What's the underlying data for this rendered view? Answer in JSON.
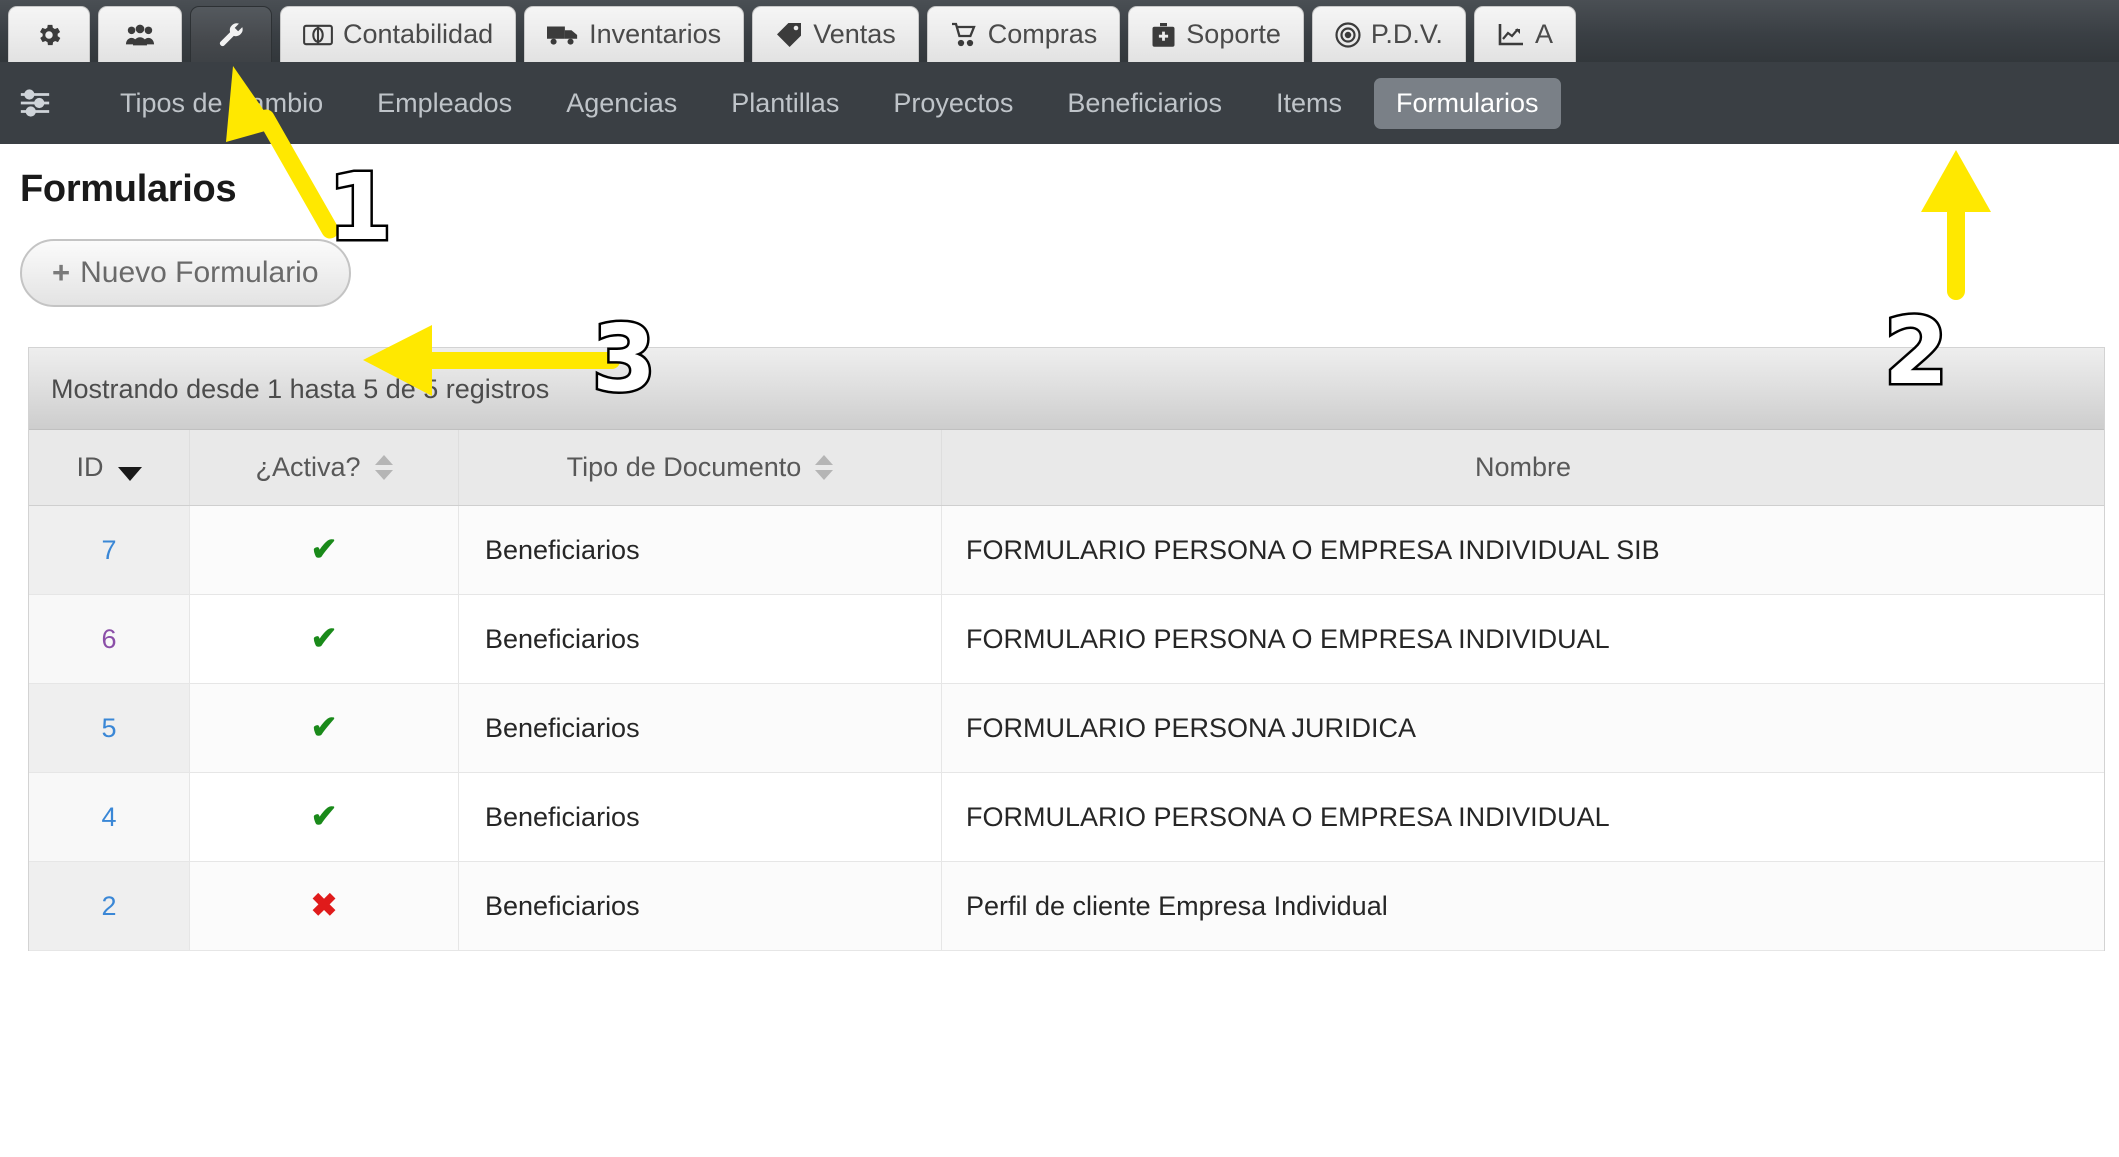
{
  "topbar": {
    "tabs": [
      {
        "label": "",
        "icon": "gear-icon",
        "icon_only": true,
        "active": false
      },
      {
        "label": "",
        "icon": "users-icon",
        "icon_only": true,
        "active": false
      },
      {
        "label": "",
        "icon": "wrench-icon",
        "icon_only": true,
        "active": true
      },
      {
        "label": "Contabilidad",
        "icon": "money-icon",
        "icon_only": false,
        "active": false
      },
      {
        "label": "Inventarios",
        "icon": "truck-icon",
        "icon_only": false,
        "active": false
      },
      {
        "label": "Ventas",
        "icon": "tag-icon",
        "icon_only": false,
        "active": false
      },
      {
        "label": "Compras",
        "icon": "cart-icon",
        "icon_only": false,
        "active": false
      },
      {
        "label": "Soporte",
        "icon": "briefcase-medical-icon",
        "icon_only": false,
        "active": false
      },
      {
        "label": "P.D.V.",
        "icon": "target-icon",
        "icon_only": false,
        "active": false
      },
      {
        "label": "A",
        "icon": "chart-line-icon",
        "icon_only": false,
        "active": false
      }
    ]
  },
  "submenu": {
    "icon": "sliders-icon",
    "items": [
      {
        "label": "Tipos de Cambio",
        "active": false
      },
      {
        "label": "Empleados",
        "active": false
      },
      {
        "label": "Agencias",
        "active": false
      },
      {
        "label": "Plantillas",
        "active": false
      },
      {
        "label": "Proyectos",
        "active": false
      },
      {
        "label": "Beneficiarios",
        "active": false
      },
      {
        "label": "Items",
        "active": false
      },
      {
        "label": "Formularios",
        "active": true
      }
    ]
  },
  "page": {
    "title": "Formularios",
    "new_button_label": "Nuevo Formulario",
    "new_button_plus": "+"
  },
  "table": {
    "info": "Mostrando desde 1 hasta 5 de 5 registros",
    "columns": [
      {
        "label": "ID",
        "sort": "desc"
      },
      {
        "label": "¿Activa?",
        "sort": "both"
      },
      {
        "label": "Tipo de Documento",
        "sort": "both"
      },
      {
        "label": "Nombre",
        "sort": "none"
      }
    ],
    "rows": [
      {
        "id": "7",
        "id_visited": false,
        "activa": "check",
        "tipo": "Beneficiarios",
        "nombre": "FORMULARIO PERSONA O EMPRESA INDIVIDUAL SIB"
      },
      {
        "id": "6",
        "id_visited": true,
        "activa": "check",
        "tipo": "Beneficiarios",
        "nombre": "FORMULARIO PERSONA O EMPRESA INDIVIDUAL"
      },
      {
        "id": "5",
        "id_visited": false,
        "activa": "check",
        "tipo": "Beneficiarios",
        "nombre": "FORMULARIO PERSONA JURIDICA"
      },
      {
        "id": "4",
        "id_visited": false,
        "activa": "check",
        "tipo": "Beneficiarios",
        "nombre": "FORMULARIO PERSONA O EMPRESA INDIVIDUAL"
      },
      {
        "id": "2",
        "id_visited": false,
        "activa": "cross",
        "tipo": "Beneficiarios",
        "nombre": "Perfil de cliente Empresa Individual"
      }
    ],
    "check_glyph": "✔",
    "cross_glyph": "✖"
  },
  "annotations": {
    "color": "#FFE800",
    "markers": [
      {
        "number": "1"
      },
      {
        "number": "2"
      },
      {
        "number": "3"
      }
    ]
  },
  "colors": {
    "topbar_bg": "#3a3f44",
    "active_tab_bg": "#46494d",
    "submenu_active_bg": "#7a8087",
    "link": "#3a87d6",
    "link_visited": "#8b4fa8",
    "check_green": "#1a8a1a",
    "cross_red": "#e01b1b",
    "annotation_yellow": "#FFE800"
  }
}
